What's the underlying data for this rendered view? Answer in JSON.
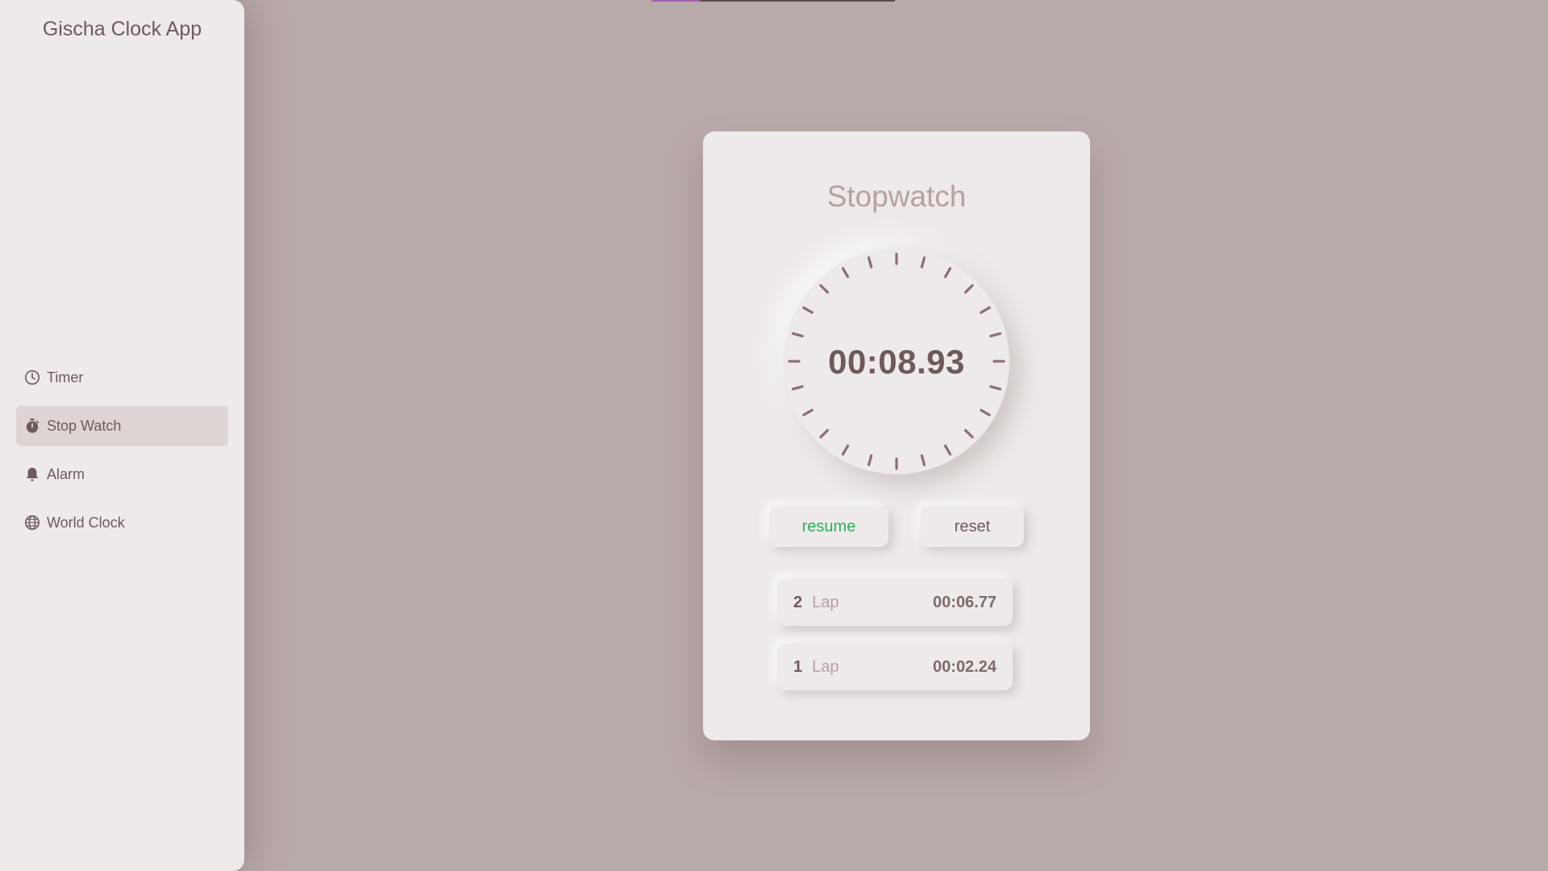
{
  "app": {
    "title": "Gischa Clock App"
  },
  "loading_bar": {
    "progress": 0.2,
    "fill_color": "#a25fb0"
  },
  "sidebar": {
    "items": [
      {
        "label": "Timer",
        "icon": "clock-icon",
        "active": false
      },
      {
        "label": "Stop Watch",
        "icon": "stopwatch-icon",
        "active": true
      },
      {
        "label": "Alarm",
        "icon": "bell-icon",
        "active": false
      },
      {
        "label": "World Clock",
        "icon": "globe-icon",
        "active": false
      }
    ]
  },
  "stopwatch": {
    "title": "Stopwatch",
    "time": "00:08.93",
    "buttons": {
      "resume_label": "resume",
      "reset_label": "reset"
    },
    "laps": [
      {
        "number": "2",
        "label": "Lap",
        "time": "00:06.77"
      },
      {
        "number": "1",
        "label": "Lap",
        "time": "00:02.24"
      }
    ]
  },
  "colors": {
    "background": "#b9aaaa",
    "panel": "#eeeae9",
    "text": "#6e5a5a",
    "muted_text": "#b6a2a2",
    "resume_green": "#27b05c",
    "tick": "#8a7070"
  }
}
